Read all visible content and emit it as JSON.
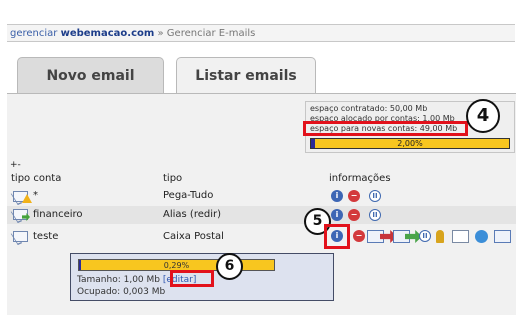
{
  "breadcrumb": {
    "prefix": "gerenciar",
    "domain": "webemacao.com",
    "sep": "»",
    "current": "Gerenciar E-mails"
  },
  "tabs": [
    {
      "label": "Novo email",
      "active": false
    },
    {
      "label": "Listar emails",
      "active": true
    }
  ],
  "quota": {
    "contratado": "espaço contratado: 50,00 Mb",
    "alocado": "espaço alocado por contas: 1,00 Mb",
    "novas": "espaço para novas contas: 49,00 Mb",
    "progress_label": "2,00%",
    "progress_fraction": 0.02
  },
  "toggle": "+-",
  "table": {
    "headers": {
      "conta": "tipo conta",
      "tipo": "tipo",
      "info": "informações"
    },
    "rows": [
      {
        "account": "*",
        "type": "Pega-Tudo",
        "icon": "warning-mail-icon"
      },
      {
        "account": "financeiro",
        "type": "Alias (redir)",
        "icon": "forward-mail-icon"
      },
      {
        "account": "teste",
        "type": "Caixa Postal",
        "icon": "mailbox-icon"
      }
    ]
  },
  "detail": {
    "progress_label": "0,29%",
    "progress_fraction": 0.0029,
    "tamanho_label": "Tamanho: 1,00 Mb",
    "editar_label": "[editar]",
    "ocupado_label": "Ocupado: 0,003 Mb"
  },
  "callouts": {
    "four": "4",
    "five": "5",
    "six": "6"
  },
  "icons": {
    "info": "i",
    "delete": "−",
    "pause": "II"
  },
  "colors": {
    "highlight": "#e2111b",
    "link": "#3058b0",
    "bar_fill": "#2b2b98",
    "bar_bg": "#f8c61f"
  }
}
